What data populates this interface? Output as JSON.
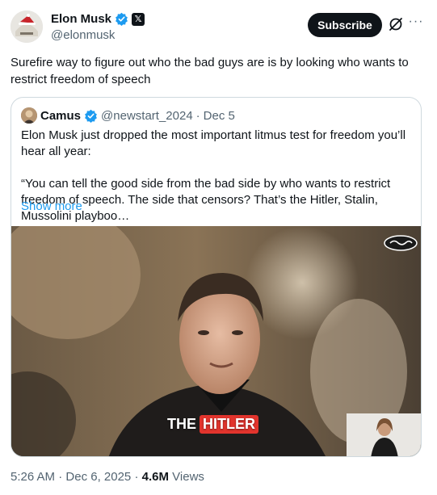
{
  "author": {
    "name": "Elon Musk",
    "handle": "@elonmusk",
    "verified": true,
    "badge_icon": "x-affiliate-badge-icon"
  },
  "actions": {
    "subscribe_label": "Subscribe",
    "grok_icon": "grok-icon",
    "more_icon": "more-icon"
  },
  "post": {
    "text": "Surefire way to figure out who the bad guys are is by looking who wants to restrict freedom of speech"
  },
  "quote": {
    "author_name": "Camus",
    "handle": "@newstart_2024",
    "separator": "·",
    "date": "Dec 5",
    "paragraph1": "Elon Musk just dropped the most important litmus test for freedom you’ll hear all year:",
    "paragraph2": "“You can tell the good side from the bad side by who wants to restrict freedom of speech. The side that censors? That’s the Hitler, Stalin, Mussolini playboo…",
    "show_more": "Show more",
    "media": {
      "caption_plain": "THE",
      "caption_highlight": "HITLER",
      "watermark": "CAMUS"
    }
  },
  "footer": {
    "time": "5:26 AM",
    "separator": "·",
    "date": "Dec 6, 2025",
    "views_count": "4.6M",
    "views_label": "Views"
  },
  "colors": {
    "text": "#0f1419",
    "secondary": "#536471",
    "link": "#1d9bf0",
    "verified": "#1d9bf0",
    "border": "#cfd9de",
    "caption_highlight": "#e2342d"
  }
}
